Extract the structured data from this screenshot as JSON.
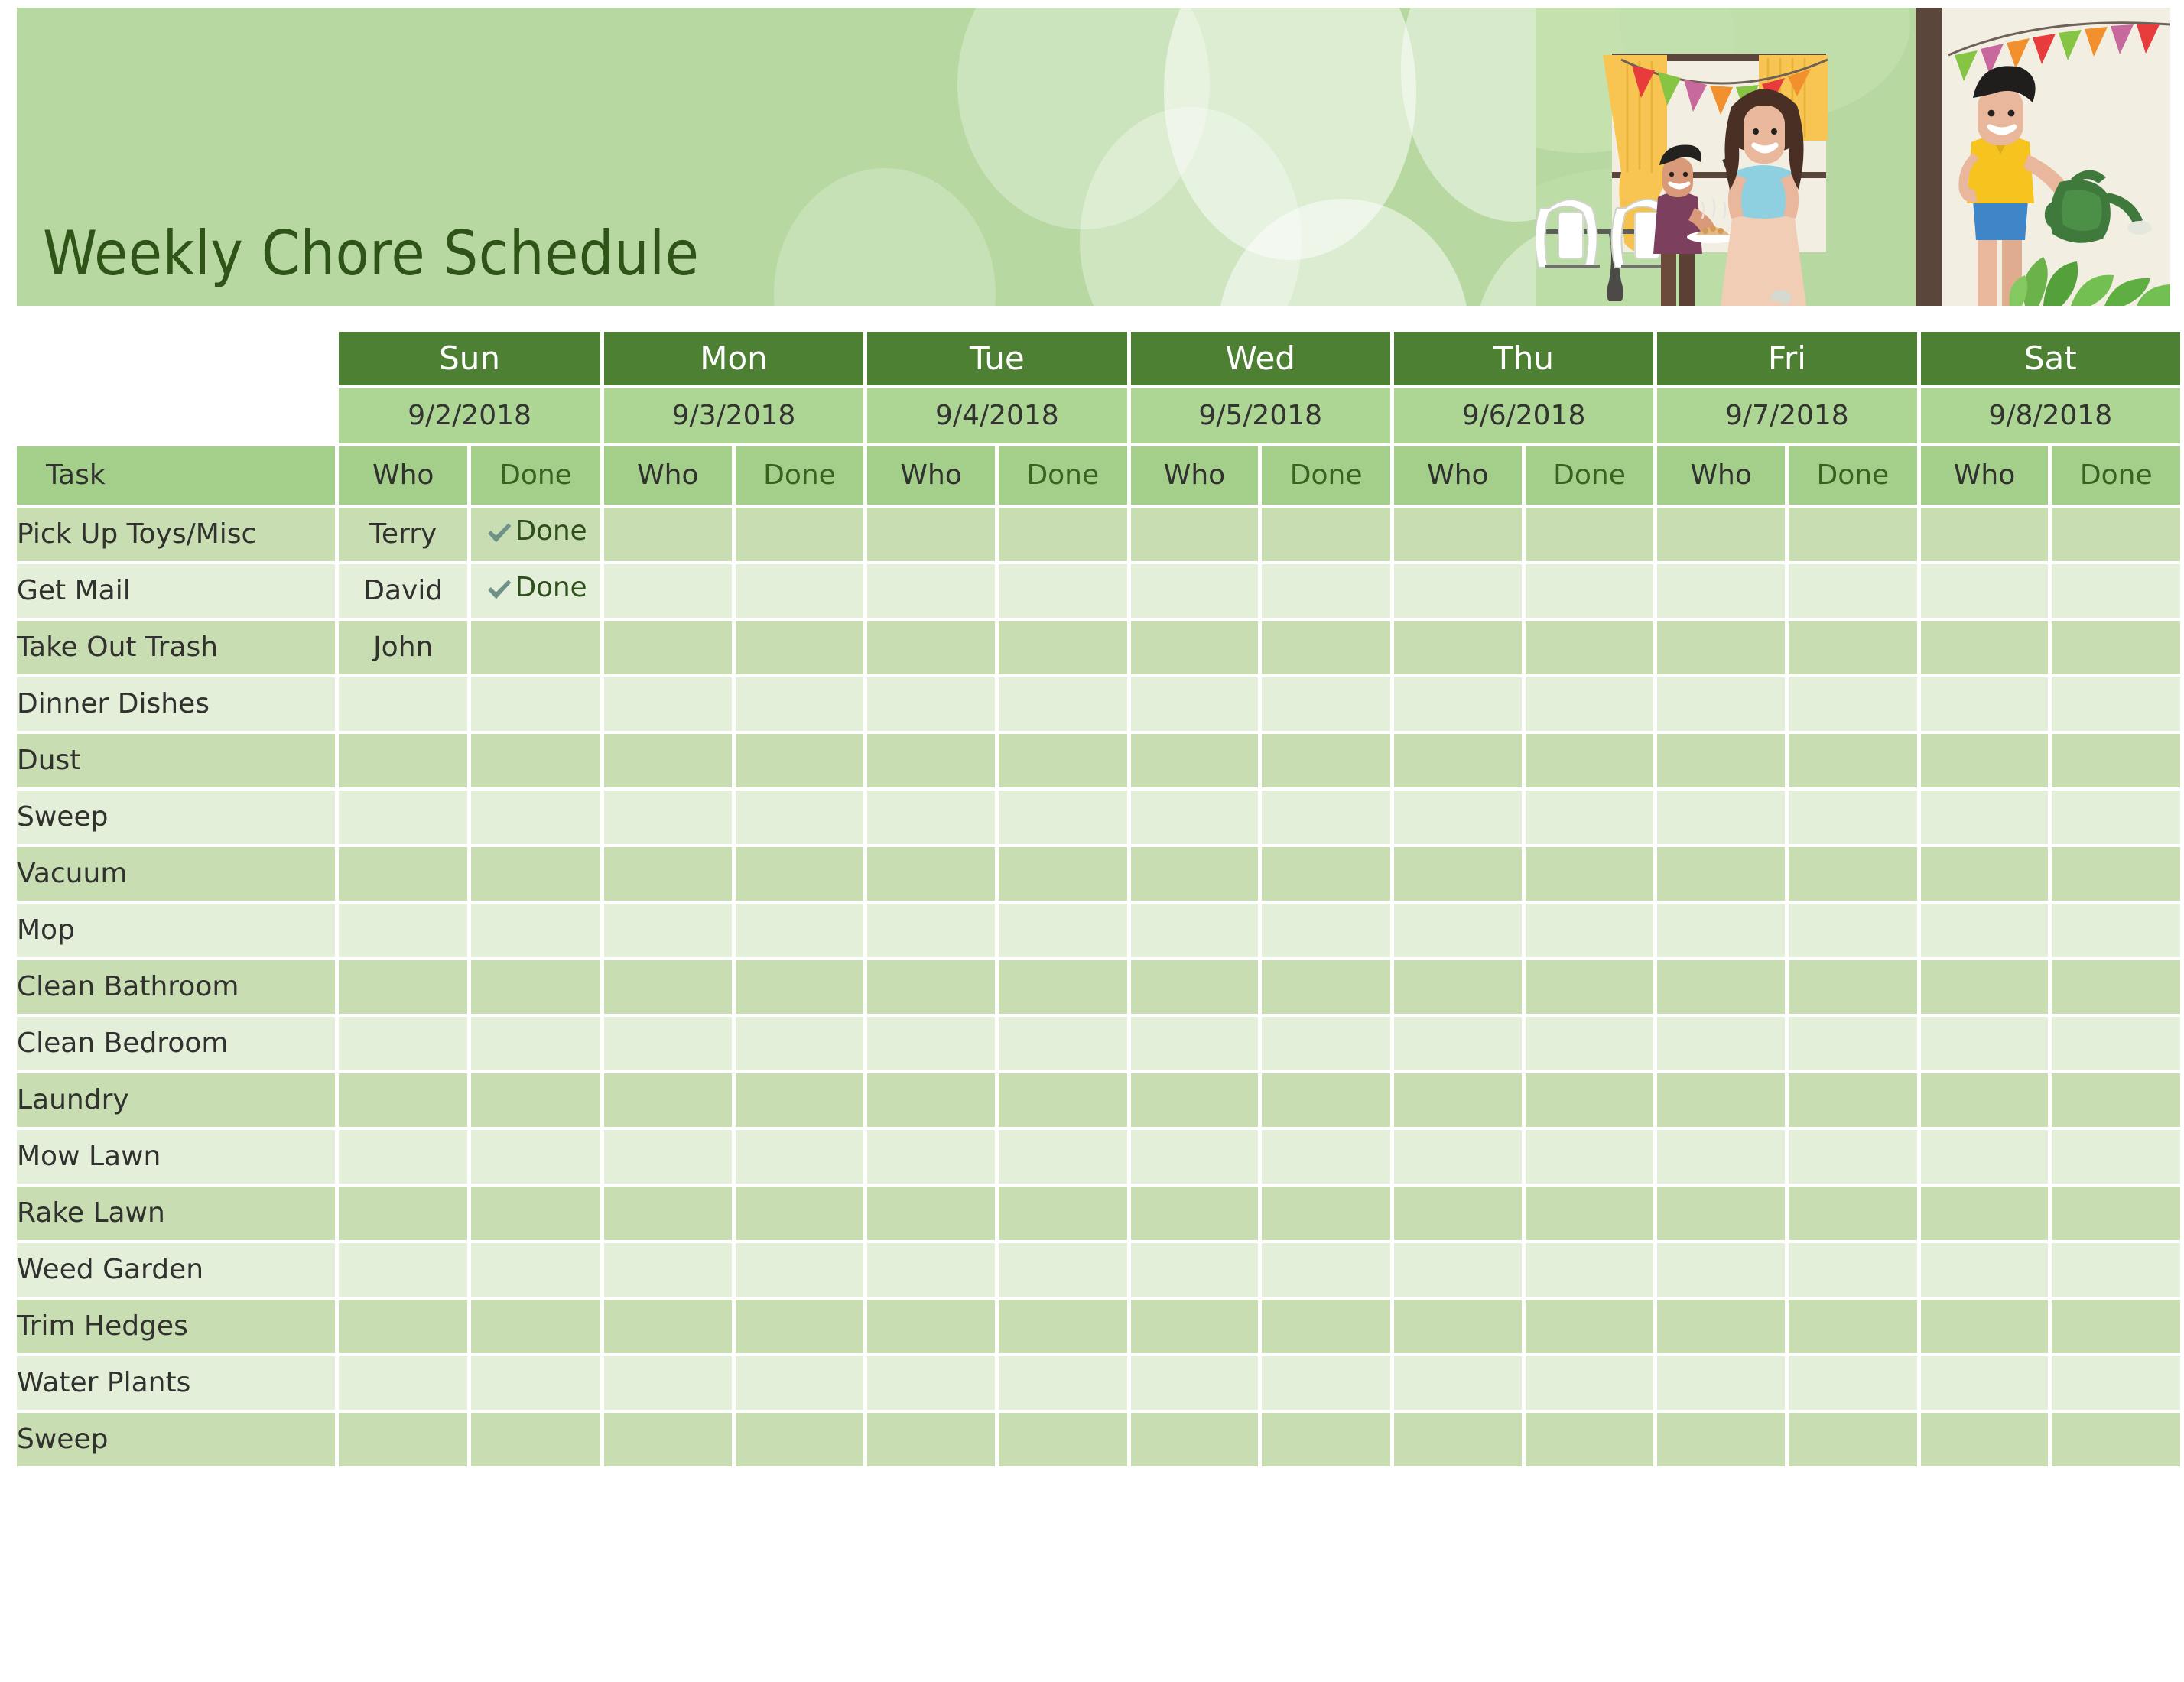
{
  "banner": {
    "title": "Weekly Chore Schedule",
    "bg_color": "#b7d9a1",
    "title_color": "#2e5418",
    "illustration_name": "family-doing-chores-illustration",
    "illustration_alt": "Mother mopping, boy carrying a plate of food, boy watering plants, party bunting, table and chairs, yellow curtain"
  },
  "table": {
    "header_bg": "#4d8033",
    "date_bg": "#add694",
    "subhead_bg": "#a4cf8b",
    "row_odd_bg": "#c8ddb1",
    "row_even_bg": "#e3efd9",
    "task_column_label": "Task",
    "who_label": "Who",
    "done_label": "Done",
    "days": [
      {
        "day": "Sun",
        "date": "9/2/2018"
      },
      {
        "day": "Mon",
        "date": "9/3/2018"
      },
      {
        "day": "Tue",
        "date": "9/4/2018"
      },
      {
        "day": "Wed",
        "date": "9/5/2018"
      },
      {
        "day": "Thu",
        "date": "9/6/2018"
      },
      {
        "day": "Fri",
        "date": "9/7/2018"
      },
      {
        "day": "Sat",
        "date": "9/8/2018"
      }
    ],
    "check_icon_color": "#6e9288",
    "done_text_color": "#2f4f1c",
    "rows": [
      {
        "task": "Pick Up Toys/Misc",
        "cells": [
          {
            "who": "Terry",
            "done": "Done"
          },
          {
            "who": "",
            "done": ""
          },
          {
            "who": "",
            "done": ""
          },
          {
            "who": "",
            "done": ""
          },
          {
            "who": "",
            "done": ""
          },
          {
            "who": "",
            "done": ""
          },
          {
            "who": "",
            "done": ""
          }
        ]
      },
      {
        "task": "Get Mail",
        "cells": [
          {
            "who": "David",
            "done": "Done"
          },
          {
            "who": "",
            "done": ""
          },
          {
            "who": "",
            "done": ""
          },
          {
            "who": "",
            "done": ""
          },
          {
            "who": "",
            "done": ""
          },
          {
            "who": "",
            "done": ""
          },
          {
            "who": "",
            "done": ""
          }
        ]
      },
      {
        "task": "Take Out Trash",
        "cells": [
          {
            "who": "John",
            "done": ""
          },
          {
            "who": "",
            "done": ""
          },
          {
            "who": "",
            "done": ""
          },
          {
            "who": "",
            "done": ""
          },
          {
            "who": "",
            "done": ""
          },
          {
            "who": "",
            "done": ""
          },
          {
            "who": "",
            "done": ""
          }
        ]
      },
      {
        "task": "Dinner Dishes",
        "cells": [
          {
            "who": "",
            "done": ""
          },
          {
            "who": "",
            "done": ""
          },
          {
            "who": "",
            "done": ""
          },
          {
            "who": "",
            "done": ""
          },
          {
            "who": "",
            "done": ""
          },
          {
            "who": "",
            "done": ""
          },
          {
            "who": "",
            "done": ""
          }
        ]
      },
      {
        "task": "Dust",
        "cells": [
          {
            "who": "",
            "done": ""
          },
          {
            "who": "",
            "done": ""
          },
          {
            "who": "",
            "done": ""
          },
          {
            "who": "",
            "done": ""
          },
          {
            "who": "",
            "done": ""
          },
          {
            "who": "",
            "done": ""
          },
          {
            "who": "",
            "done": ""
          }
        ]
      },
      {
        "task": "Sweep",
        "cells": [
          {
            "who": "",
            "done": ""
          },
          {
            "who": "",
            "done": ""
          },
          {
            "who": "",
            "done": ""
          },
          {
            "who": "",
            "done": ""
          },
          {
            "who": "",
            "done": ""
          },
          {
            "who": "",
            "done": ""
          },
          {
            "who": "",
            "done": ""
          }
        ]
      },
      {
        "task": "Vacuum",
        "cells": [
          {
            "who": "",
            "done": ""
          },
          {
            "who": "",
            "done": ""
          },
          {
            "who": "",
            "done": ""
          },
          {
            "who": "",
            "done": ""
          },
          {
            "who": "",
            "done": ""
          },
          {
            "who": "",
            "done": ""
          },
          {
            "who": "",
            "done": ""
          }
        ]
      },
      {
        "task": "Mop",
        "cells": [
          {
            "who": "",
            "done": ""
          },
          {
            "who": "",
            "done": ""
          },
          {
            "who": "",
            "done": ""
          },
          {
            "who": "",
            "done": ""
          },
          {
            "who": "",
            "done": ""
          },
          {
            "who": "",
            "done": ""
          },
          {
            "who": "",
            "done": ""
          }
        ]
      },
      {
        "task": "Clean Bathroom",
        "cells": [
          {
            "who": "",
            "done": ""
          },
          {
            "who": "",
            "done": ""
          },
          {
            "who": "",
            "done": ""
          },
          {
            "who": "",
            "done": ""
          },
          {
            "who": "",
            "done": ""
          },
          {
            "who": "",
            "done": ""
          },
          {
            "who": "",
            "done": ""
          }
        ]
      },
      {
        "task": "Clean Bedroom",
        "cells": [
          {
            "who": "",
            "done": ""
          },
          {
            "who": "",
            "done": ""
          },
          {
            "who": "",
            "done": ""
          },
          {
            "who": "",
            "done": ""
          },
          {
            "who": "",
            "done": ""
          },
          {
            "who": "",
            "done": ""
          },
          {
            "who": "",
            "done": ""
          }
        ]
      },
      {
        "task": "Laundry",
        "cells": [
          {
            "who": "",
            "done": ""
          },
          {
            "who": "",
            "done": ""
          },
          {
            "who": "",
            "done": ""
          },
          {
            "who": "",
            "done": ""
          },
          {
            "who": "",
            "done": ""
          },
          {
            "who": "",
            "done": ""
          },
          {
            "who": "",
            "done": ""
          }
        ]
      },
      {
        "task": "Mow Lawn",
        "cells": [
          {
            "who": "",
            "done": ""
          },
          {
            "who": "",
            "done": ""
          },
          {
            "who": "",
            "done": ""
          },
          {
            "who": "",
            "done": ""
          },
          {
            "who": "",
            "done": ""
          },
          {
            "who": "",
            "done": ""
          },
          {
            "who": "",
            "done": ""
          }
        ]
      },
      {
        "task": "Rake Lawn",
        "cells": [
          {
            "who": "",
            "done": ""
          },
          {
            "who": "",
            "done": ""
          },
          {
            "who": "",
            "done": ""
          },
          {
            "who": "",
            "done": ""
          },
          {
            "who": "",
            "done": ""
          },
          {
            "who": "",
            "done": ""
          },
          {
            "who": "",
            "done": ""
          }
        ]
      },
      {
        "task": "Weed Garden",
        "cells": [
          {
            "who": "",
            "done": ""
          },
          {
            "who": "",
            "done": ""
          },
          {
            "who": "",
            "done": ""
          },
          {
            "who": "",
            "done": ""
          },
          {
            "who": "",
            "done": ""
          },
          {
            "who": "",
            "done": ""
          },
          {
            "who": "",
            "done": ""
          }
        ]
      },
      {
        "task": "Trim Hedges",
        "cells": [
          {
            "who": "",
            "done": ""
          },
          {
            "who": "",
            "done": ""
          },
          {
            "who": "",
            "done": ""
          },
          {
            "who": "",
            "done": ""
          },
          {
            "who": "",
            "done": ""
          },
          {
            "who": "",
            "done": ""
          },
          {
            "who": "",
            "done": ""
          }
        ]
      },
      {
        "task": "Water Plants",
        "cells": [
          {
            "who": "",
            "done": ""
          },
          {
            "who": "",
            "done": ""
          },
          {
            "who": "",
            "done": ""
          },
          {
            "who": "",
            "done": ""
          },
          {
            "who": "",
            "done": ""
          },
          {
            "who": "",
            "done": ""
          },
          {
            "who": "",
            "done": ""
          }
        ]
      },
      {
        "task": "Sweep",
        "cells": [
          {
            "who": "",
            "done": ""
          },
          {
            "who": "",
            "done": ""
          },
          {
            "who": "",
            "done": ""
          },
          {
            "who": "",
            "done": ""
          },
          {
            "who": "",
            "done": ""
          },
          {
            "who": "",
            "done": ""
          },
          {
            "who": "",
            "done": ""
          }
        ]
      }
    ]
  }
}
